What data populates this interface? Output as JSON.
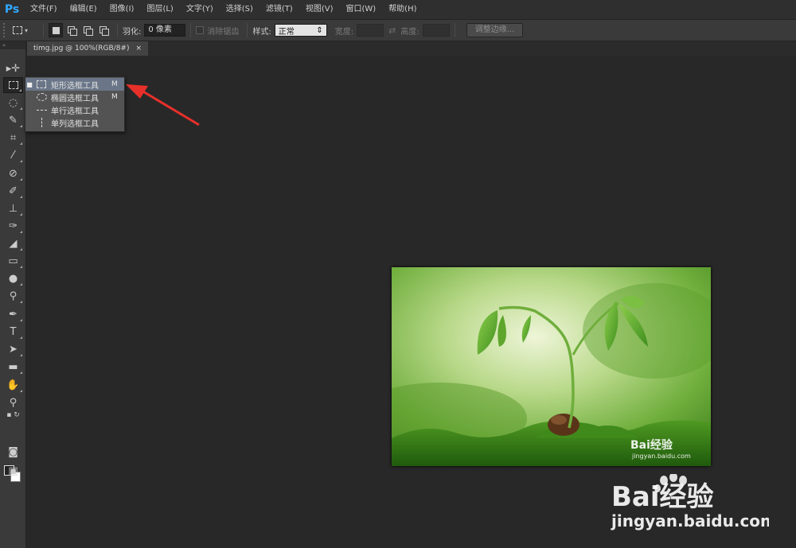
{
  "app": {
    "logo": "Ps"
  },
  "menu": [
    "文件(F)",
    "编辑(E)",
    "图像(I)",
    "图层(L)",
    "文字(Y)",
    "选择(S)",
    "滤镜(T)",
    "视图(V)",
    "窗口(W)",
    "帮助(H)"
  ],
  "options": {
    "feather_label": "羽化:",
    "feather_value": "0 像素",
    "antialias_label": "消除锯齿",
    "style_label": "样式:",
    "style_value": "正常",
    "width_label": "宽度:",
    "height_label": "高度:",
    "refine_label": "调整边缘..."
  },
  "document": {
    "tab_title": "timg.jpg @ 100%(RGB/8#)",
    "close_glyph": "×"
  },
  "flyout": {
    "items": [
      {
        "label": "矩形选框工具",
        "shortcut": "M",
        "active": true,
        "icon": "rect-marquee-icon"
      },
      {
        "label": "椭圆选框工具",
        "shortcut": "M",
        "active": false,
        "icon": "ellipse-marquee-icon"
      },
      {
        "label": "单行选框工具",
        "shortcut": "",
        "active": false,
        "icon": "single-row-marquee-icon"
      },
      {
        "label": "单列选框工具",
        "shortcut": "",
        "active": false,
        "icon": "single-column-marquee-icon"
      }
    ]
  },
  "image": {
    "watermark_brand": "Bai经验",
    "watermark_url": "jingyan.baidu.com"
  },
  "page_watermark": {
    "brand": "Bai经验",
    "url": "jingyan.baidu.com"
  },
  "colors": {
    "accent": "#31a8ff",
    "annotation_arrow": "#e8302a",
    "flyout_highlight": "#6a7688"
  }
}
